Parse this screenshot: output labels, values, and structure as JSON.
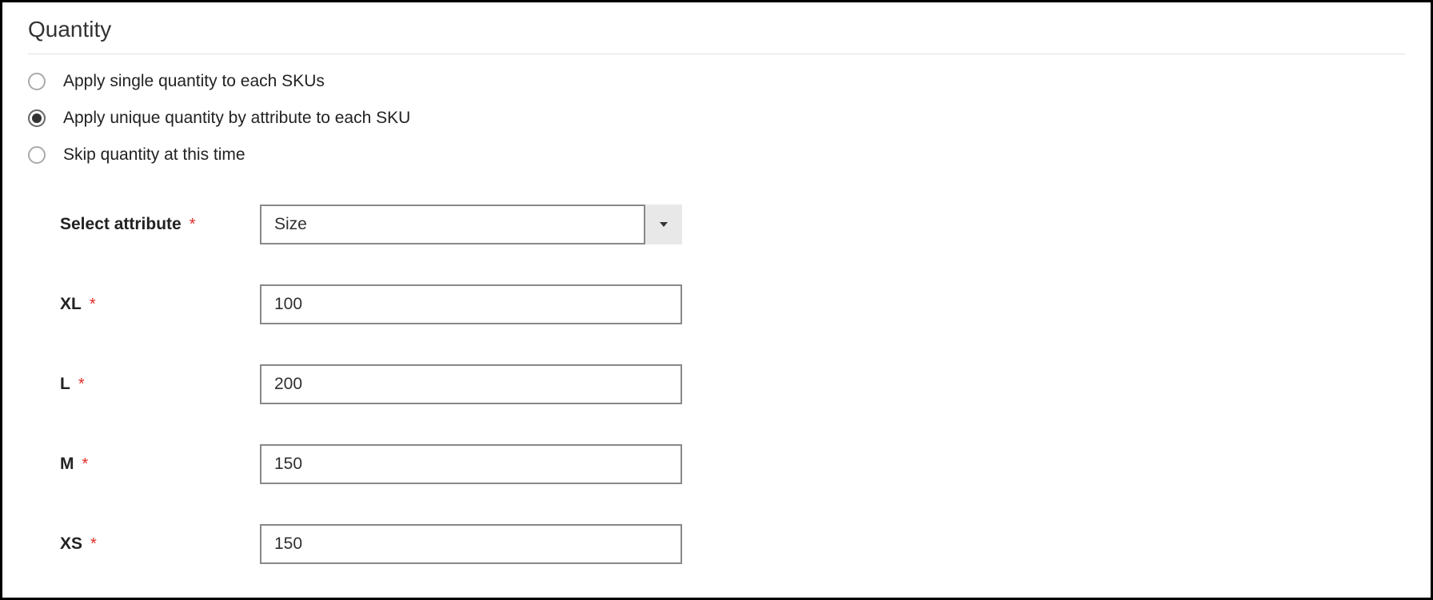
{
  "section": {
    "title": "Quantity"
  },
  "radios": {
    "option_single": "Apply single quantity to each SKUs",
    "option_unique": "Apply unique quantity by attribute to each SKU",
    "option_skip": "Skip quantity at this time",
    "selected": "unique"
  },
  "form": {
    "select_attribute_label": "Select attribute",
    "select_attribute_value": "Size",
    "rows": {
      "xl": {
        "label": "XL",
        "value": "100"
      },
      "l": {
        "label": "L",
        "value": "200"
      },
      "m": {
        "label": "M",
        "value": "150"
      },
      "xs": {
        "label": "XS",
        "value": "150"
      }
    },
    "required_mark": "*"
  }
}
